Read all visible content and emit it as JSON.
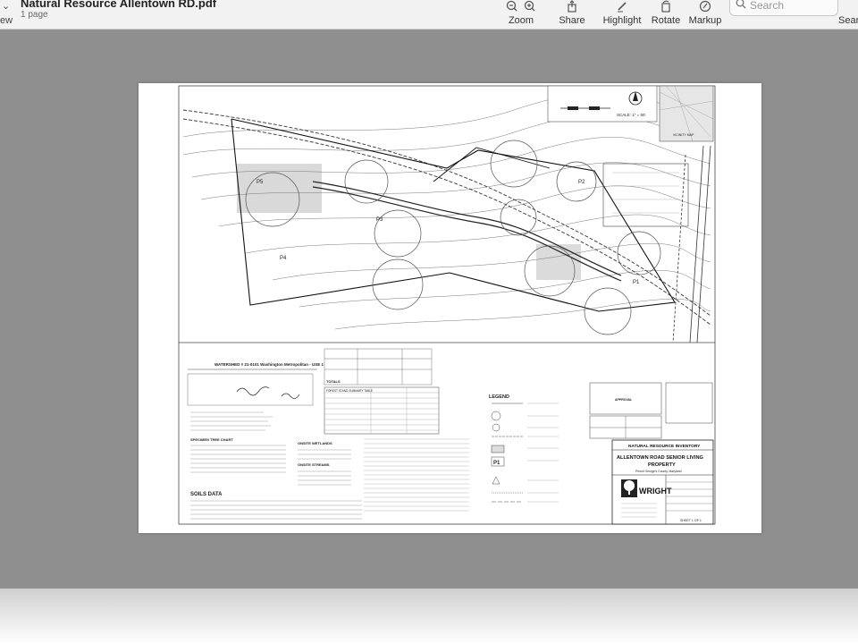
{
  "window": {
    "title": "Natural Resource Allentown RD.pdf",
    "subtitle": "1 page",
    "view_label": "ew"
  },
  "toolbar": {
    "zoom": "Zoom",
    "share": "Share",
    "highlight": "Highlight",
    "rotate": "Rotate",
    "markup": "Markup",
    "search_placeholder": "Search",
    "search_label": "Searc"
  },
  "plan": {
    "title_block": {
      "heading": "NATURAL RESOURCE INVENTORY",
      "project_line1": "ALLENTOWN ROAD SENIOR LIVING",
      "project_line2": "PROPERTY",
      "county": "Prince George's County, Maryland",
      "company": "WRIGHT",
      "sheet": "SHEET 1 OF 1"
    },
    "scale": "SCALE: 1\" = 50'",
    "vicinity": "VICINITY MAP",
    "watershed": "WATERSHED # 21-0101 Washington Metropolitan - USE 1",
    "totals": "TOTALS",
    "legend": "LEGEND",
    "soils": "SOILS DATA",
    "specimen": "SPECIMEN TREE CHART",
    "onsite_wetlands": "ONSITE WETLANDS",
    "onsite_streams": "ONSITE STREAMS",
    "forest_summary": "FOREST STAND SUMMARY TABLE",
    "approval": "APPROVAL",
    "plots": [
      "P1",
      "P2",
      "P3",
      "P4",
      "P5"
    ]
  }
}
